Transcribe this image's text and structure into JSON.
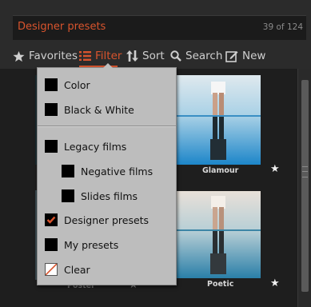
{
  "header": {
    "title": "Designer presets",
    "count": "39 of 124"
  },
  "toolbar": {
    "favorites_label": "Favorites",
    "filter_label": "Filter",
    "sort_label": "Sort",
    "search_label": "Search",
    "new_label": "New"
  },
  "grid": {
    "cells": [
      {
        "label": "Glamour",
        "favorite": true
      },
      {
        "label": "Poster",
        "favorite": false
      },
      {
        "label": "Poetic",
        "favorite": true
      }
    ]
  },
  "filter_menu": {
    "items": [
      {
        "label": "Color",
        "checked": false
      },
      {
        "label": "Black & White",
        "checked": false
      },
      {
        "label": "Legacy films",
        "checked": false
      },
      {
        "label": "Negative films",
        "checked": false
      },
      {
        "label": "Slides films",
        "checked": false
      },
      {
        "label": "Designer presets",
        "checked": true
      },
      {
        "label": "My presets",
        "checked": false
      },
      {
        "label": "Clear",
        "checked": false
      }
    ]
  },
  "colors": {
    "accent": "#d9542d",
    "background": "#2b2b2b",
    "menu_background": "#bdbdbd"
  }
}
